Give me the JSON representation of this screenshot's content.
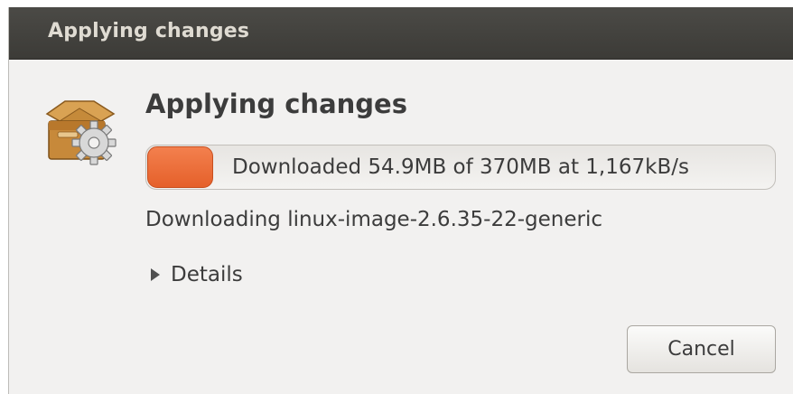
{
  "window": {
    "title": "Applying changes"
  },
  "dialog": {
    "icon": "package-gear-icon",
    "heading": "Applying changes",
    "progress": {
      "fraction": 0.105,
      "text": "Downloaded 54.9MB of 370MB at 1,167kB/s"
    },
    "status": "Downloading linux-image-2.6.35-22-generic",
    "details_label": "Details",
    "cancel_label": "Cancel"
  },
  "colors": {
    "titlebar": "#3c3b37",
    "progress_fill": "#e9612b",
    "background": "#f2f1f0"
  }
}
